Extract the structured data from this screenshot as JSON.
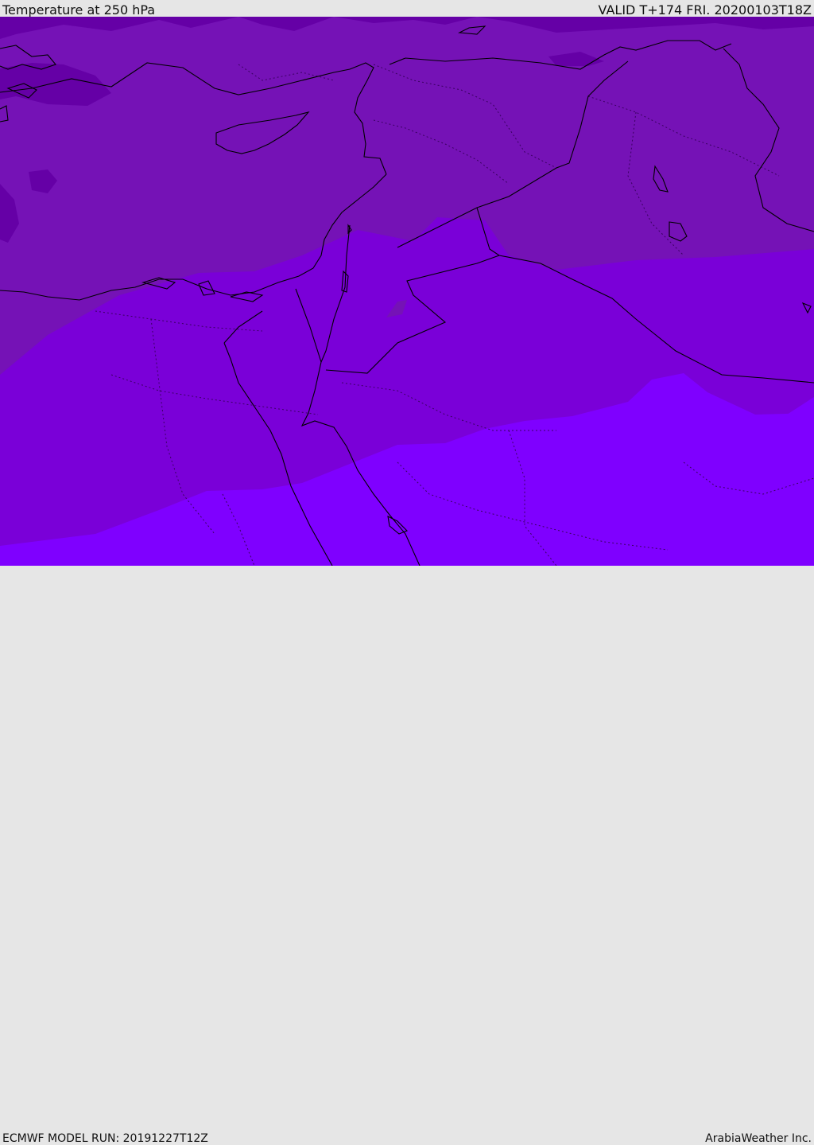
{
  "header": {
    "title": "Temperature at 250 hPa",
    "valid": "VALID T+174 FRI. 20200103T18Z"
  },
  "footer": {
    "model_run": "ECMWF MODEL RUN: 20191227T12Z",
    "credit": "ArabiaWeather Inc."
  },
  "colors": {
    "band_coldest": "#6500a6",
    "band_cold": "#7512b6",
    "band_mid": "#7a00d8",
    "band_warm": "#7f00ff",
    "coast": "#000000"
  }
}
